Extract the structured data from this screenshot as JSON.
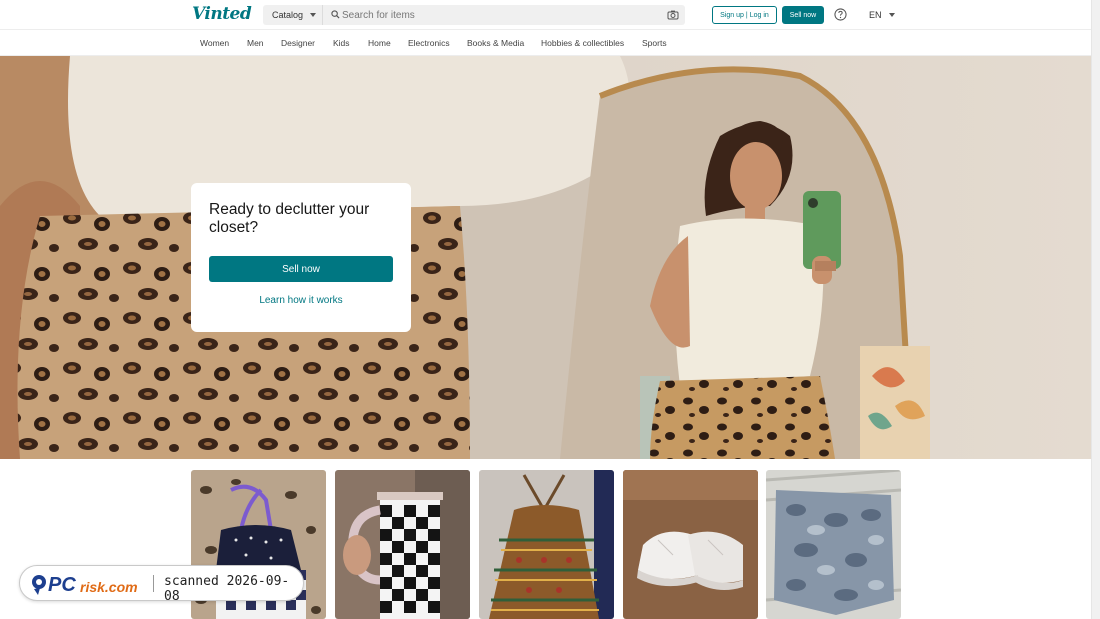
{
  "header": {
    "logo_text": "Vinted",
    "catalog_label": "Catalog",
    "search_placeholder": "Search for items",
    "signup_label": "Sign up",
    "login_label": "Log in",
    "auth_separator": "|",
    "sell_label": "Sell now",
    "language": "EN",
    "brand_color": "#007782"
  },
  "nav": {
    "items": [
      "Women",
      "Men",
      "Designer",
      "Kids",
      "Home",
      "Electronics",
      "Books & Media",
      "Hobbies & collectibles",
      "Sports"
    ]
  },
  "hero": {
    "title": "Ready to declutter your closet?",
    "sell_button": "Sell now",
    "learn_link": "Learn how it works"
  },
  "items": [
    {
      "subject": "halter swimsuit on leopard print"
    },
    {
      "subject": "checkered tumbler cup"
    },
    {
      "subject": "patterned halter dress"
    },
    {
      "subject": "white sneakers on couch"
    },
    {
      "subject": "camo print shorts"
    }
  ],
  "watermark": {
    "logo_text": "PCrisk.com",
    "scan_text": "scanned 2026-09-08"
  }
}
